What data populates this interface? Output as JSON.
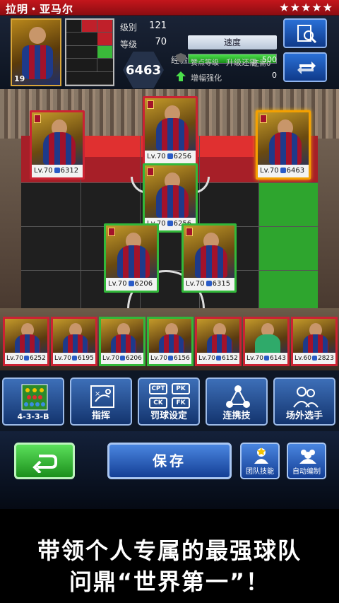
{
  "header": {
    "player_name": "拉明・亚马尔",
    "stars": "★★★★★"
  },
  "player": {
    "portrait_number": "19",
    "rank_label": "级别",
    "rank_value": "121",
    "level_label": "等级",
    "level_value": "70",
    "rating": "6463",
    "trait": "速度",
    "exp_label": "经验",
    "exp_remaining": "还需0",
    "exp_fill": 1.0,
    "sponsor_label": "赞点等级",
    "upgrade_label": "升级还需",
    "upgrade_value": "500",
    "boost_label": "增幅强化",
    "boost_value": "0"
  },
  "pitch_cards": [
    {
      "level": "Lv.70",
      "rating": "6312",
      "border": "red"
    },
    {
      "level": "Lv.70",
      "rating": "6256",
      "border": "red"
    },
    {
      "level": "Lv.70",
      "rating": "6463",
      "border": "orange"
    },
    {
      "level": "Lv.70",
      "rating": "6256",
      "border": "green"
    },
    {
      "level": "Lv.70",
      "rating": "6206",
      "border": "green"
    },
    {
      "level": "Lv.70",
      "rating": "6315",
      "border": "green"
    }
  ],
  "bench_cards": [
    {
      "level": "Lv.70",
      "rating": "6252",
      "border": "red",
      "gk": false
    },
    {
      "level": "Lv.70",
      "rating": "6195",
      "border": "red",
      "gk": false
    },
    {
      "level": "Lv.70",
      "rating": "6206",
      "border": "green",
      "gk": false
    },
    {
      "level": "Lv.70",
      "rating": "6156",
      "border": "green",
      "gk": false
    },
    {
      "level": "Lv.70",
      "rating": "6152",
      "border": "red",
      "gk": false
    },
    {
      "level": "Lv.70",
      "rating": "6143",
      "border": "red",
      "gk": true
    },
    {
      "level": "Lv.60",
      "rating": "2823",
      "border": "red",
      "gk": false
    }
  ],
  "menu": {
    "formation": "4-3-3-B",
    "tactics": "指挥",
    "set_pieces": "罚球设定",
    "set_piece_keys": [
      "CPT",
      "PK",
      "CK",
      "FK"
    ],
    "combos": "连携技",
    "subs": "场外选手"
  },
  "actions": {
    "save": "保存",
    "team_skill": "团队技能",
    "auto_edit": "自动编制"
  },
  "caption": {
    "line1": "带领个人专属的最强球队",
    "line2": "问鼎“世界第一”！"
  },
  "colors": {
    "header_red": "#c4161c",
    "button_blue": "#2a70d6",
    "confirm_green": "#32b83a"
  }
}
